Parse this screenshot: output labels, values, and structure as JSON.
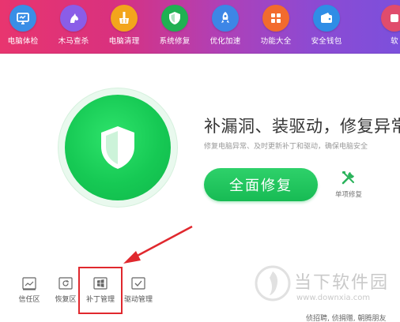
{
  "toolbar": {
    "items": [
      {
        "label": "电脑体检",
        "icon": "monitor-icon",
        "color": "#3a8ee6"
      },
      {
        "label": "木马查杀",
        "icon": "horse-icon",
        "color": "#8a5de8"
      },
      {
        "label": "电脑清理",
        "icon": "broom-icon",
        "color": "#f3a51c"
      },
      {
        "label": "系统修复",
        "icon": "shield-icon",
        "color": "#1fb052"
      },
      {
        "label": "优化加速",
        "icon": "rocket-icon",
        "color": "#3d86e6"
      },
      {
        "label": "功能大全",
        "icon": "grid-icon",
        "color": "#f26b2e"
      },
      {
        "label": "安全钱包",
        "icon": "wallet-icon",
        "color": "#2f8de6"
      },
      {
        "label": "软",
        "icon": "software-icon",
        "color": "#e04c6c"
      }
    ]
  },
  "main": {
    "shield_icon": "shield-icon",
    "headline": "补漏洞、装驱动，修复异常",
    "subline": "修复电脑异常、及时更新补丁和驱动，确保电脑安全",
    "repair_button": "全面修复",
    "single_repair": "单项修复",
    "brand_green": "#17bb54"
  },
  "bottom_bar": {
    "items": [
      {
        "label": "信任区",
        "icon": "trust-zone-icon"
      },
      {
        "label": "恢复区",
        "icon": "restore-zone-icon"
      },
      {
        "label": "补丁管理",
        "icon": "windows-icon",
        "highlighted": true
      },
      {
        "label": "驱动管理",
        "icon": "driver-icon"
      }
    ],
    "highlight_color": "#e0282e"
  },
  "watermark": {
    "name": "当下软件园",
    "url": "www.downxia.com"
  },
  "footer": {
    "partial_text": "侦招聘, 侦捐赠, 朝腾朋友"
  }
}
